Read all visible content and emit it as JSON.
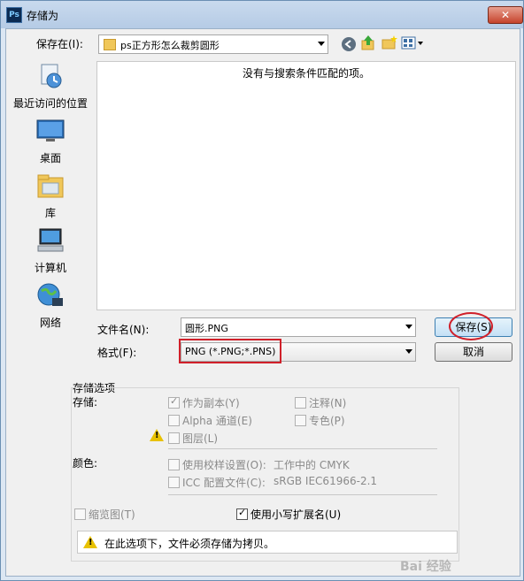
{
  "window": {
    "title": "存储为",
    "close_glyph": "✕"
  },
  "save_in": {
    "label": "保存在(I):",
    "folder": "ps正方形怎么裁剪圆形"
  },
  "sidebar": {
    "items": [
      {
        "label": "最近访问的位置",
        "icon": "recent-places-icon"
      },
      {
        "label": "桌面",
        "icon": "desktop-icon"
      },
      {
        "label": "库",
        "icon": "library-icon"
      },
      {
        "label": "计算机",
        "icon": "computer-icon"
      },
      {
        "label": "网络",
        "icon": "network-icon"
      }
    ]
  },
  "file_list": {
    "empty_message": "没有与搜索条件匹配的项。"
  },
  "filename": {
    "label": "文件名(N):",
    "value": "圆形.PNG"
  },
  "format": {
    "label": "格式(F):",
    "value": "PNG (*.PNG;*.PNS)"
  },
  "buttons": {
    "save": "保存(S)",
    "cancel": "取消"
  },
  "options": {
    "header": "存储选项",
    "storage_label": "存储:",
    "as_copy": "作为副本(Y)",
    "annotations": "注释(N)",
    "alpha": "Alpha 通道(E)",
    "spot": "专色(P)",
    "layers": "图层(L)",
    "color_label": "颜色:",
    "use_proof": "使用校样设置(O):",
    "proof_value": "工作中的 CMYK",
    "icc": "ICC 配置文件(C):",
    "icc_value": "sRGB IEC61966-2.1",
    "thumbnail": "缩览图(T)",
    "lowercase_ext": "使用小写扩展名(U)",
    "note": "在此选项下，文件必须存储为拷贝。"
  },
  "watermark": "Bai 经验",
  "colors": {
    "highlight": "#d0202a",
    "title_bar": "#c9daee"
  }
}
